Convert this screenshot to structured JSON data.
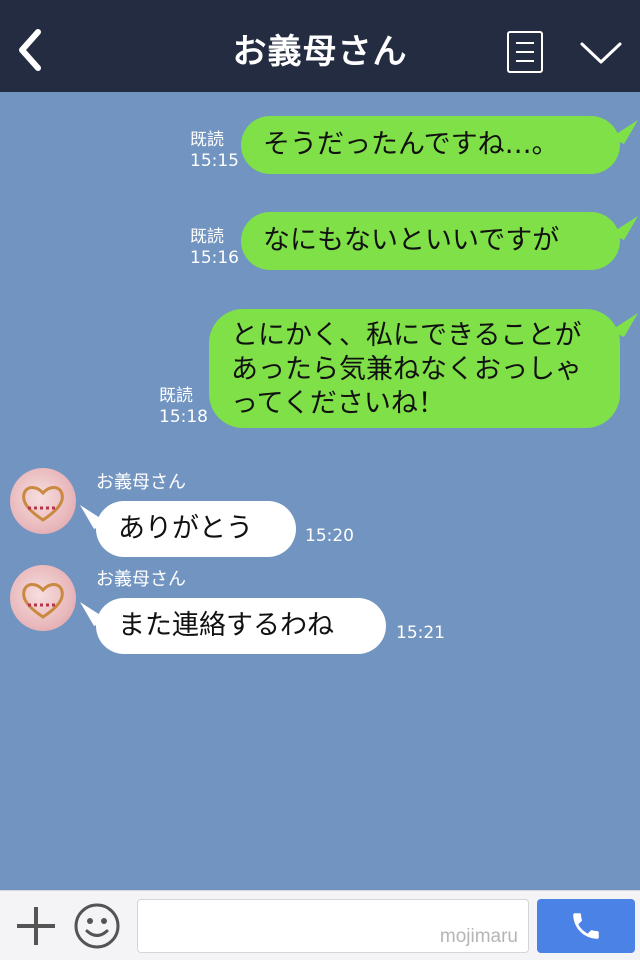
{
  "header": {
    "title": "お義母さん",
    "back_icon": "chevron-left-icon",
    "menu_icon": "list-icon",
    "more_icon": "chevron-down-icon"
  },
  "messages_out": [
    {
      "text": "そうだったんですね…。",
      "read": "既読",
      "time": "15:15"
    },
    {
      "text": "なにもないといいですが",
      "read": "既読",
      "time": "15:16"
    },
    {
      "text": "とにかく、私にできることがあったら気兼ねなくおっしゃってくださいね！",
      "read": "既読",
      "time": "15:18"
    }
  ],
  "messages_in": [
    {
      "sender": "お義母さん",
      "text": "ありがとう",
      "time": "15:20"
    },
    {
      "sender": "お義母さん",
      "text": "また連絡するわね",
      "time": "15:21"
    }
  ],
  "footer": {
    "input_value": "",
    "watermark": "mojimaru",
    "add_icon": "plus-icon",
    "emoji_icon": "smiley-icon",
    "call_icon": "phone-icon"
  },
  "colors": {
    "background": "#7194c0",
    "header": "#232c41",
    "outgoing_bubble": "#7fe048",
    "incoming_bubble": "#ffffff",
    "call_button": "#4b82e5"
  }
}
